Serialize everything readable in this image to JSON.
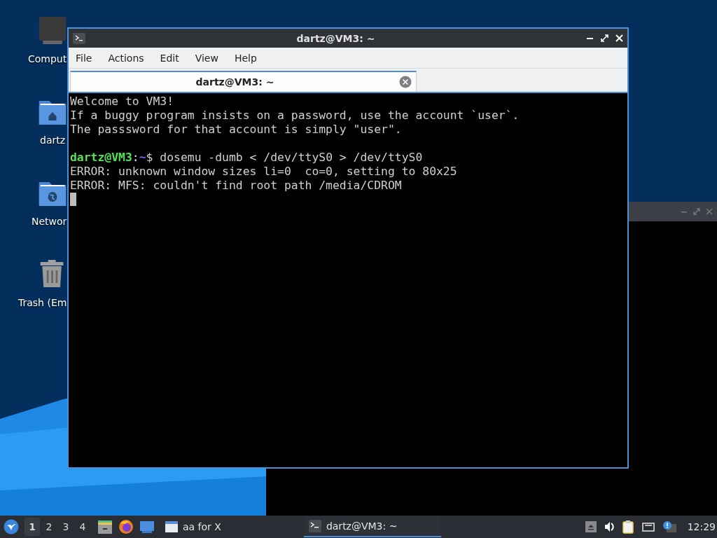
{
  "desktop_icons": [
    {
      "label": "Comput",
      "kind": "computer"
    },
    {
      "label": "dartz",
      "kind": "home"
    },
    {
      "label": "Networ",
      "kind": "network"
    },
    {
      "label": "Trash (Em",
      "kind": "trash"
    }
  ],
  "terminal": {
    "title": "dartz@VM3: ~",
    "menu": [
      "File",
      "Actions",
      "Edit",
      "View",
      "Help"
    ],
    "tabs": [
      {
        "label": "dartz@VM3: ~",
        "selected": true
      }
    ],
    "lines": [
      {
        "kind": "output",
        "text": "Welcome to VM3!"
      },
      {
        "kind": "output",
        "text": "If a buggy program insists on a password, use the account `user`."
      },
      {
        "kind": "output",
        "text": "The passsword for that account is simply \"user\"."
      },
      {
        "kind": "blank"
      },
      {
        "kind": "prompt",
        "user": "dartz@VM3",
        "separator": ":",
        "path": "~",
        "command": "$ dosemu -dumb < /dev/ttyS0 > /dev/ttyS0"
      },
      {
        "kind": "output",
        "text": "ERROR: unknown window sizes li=0  co=0, setting to 80x25"
      },
      {
        "kind": "output",
        "text": "ERROR: MFS: couldn't find root path /media/CDROM"
      }
    ],
    "cursor": true
  },
  "taskbar": {
    "desktops": [
      {
        "label": "1",
        "selected": true
      },
      {
        "label": "2",
        "selected": false
      },
      {
        "label": "3",
        "selected": false
      },
      {
        "label": "4",
        "selected": false
      }
    ],
    "tasks": [
      {
        "label": "aa for X",
        "kind": "window",
        "selected": false
      },
      {
        "label": "dartz@VM3: ~",
        "kind": "terminal",
        "selected": true
      }
    ],
    "clock": "12:29"
  }
}
